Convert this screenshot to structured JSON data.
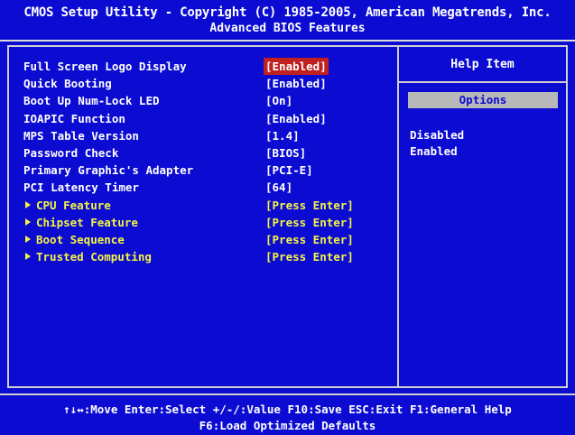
{
  "title": {
    "line1": "CMOS Setup Utility - Copyright (C) 1985-2005, American Megatrends, Inc.",
    "line2": "Advanced BIOS Features"
  },
  "settings": [
    {
      "label": "Full Screen Logo Display",
      "value": "[Enabled]",
      "selected": true
    },
    {
      "label": "Quick Booting",
      "value": "[Enabled]"
    },
    {
      "label": "Boot Up Num-Lock LED",
      "value": "[On]"
    },
    {
      "label": "IOAPIC Function",
      "value": "[Enabled]"
    },
    {
      "label": "MPS Table Version",
      "value": "[1.4]"
    },
    {
      "label": "Password Check",
      "value": "[BIOS]"
    },
    {
      "label": "Primary Graphic's Adapter",
      "value": "[PCI-E]"
    },
    {
      "label": "PCI Latency Timer",
      "value": "[64]"
    },
    {
      "label": "CPU Feature",
      "value": "[Press Enter]",
      "submenu": true
    },
    {
      "label": "Chipset Feature",
      "value": "[Press Enter]",
      "submenu": true
    },
    {
      "label": "Boot Sequence",
      "value": "[Press Enter]",
      "submenu": true
    },
    {
      "label": "Trusted Computing",
      "value": "[Press Enter]",
      "submenu": true
    }
  ],
  "help": {
    "title": "Help Item",
    "options_header": "Options",
    "options": [
      "Disabled",
      "Enabled"
    ]
  },
  "footer": {
    "line1": "↑↓↔:Move  Enter:Select  +/-/:Value  F10:Save  ESC:Exit  F1:General Help",
    "line2": "F6:Load Optimized Defaults"
  },
  "colors": {
    "background": "#0b0bd2",
    "selected_highlight": "#c02020",
    "submenu_text": "#f5f542",
    "options_box": "#b8b8b8"
  }
}
